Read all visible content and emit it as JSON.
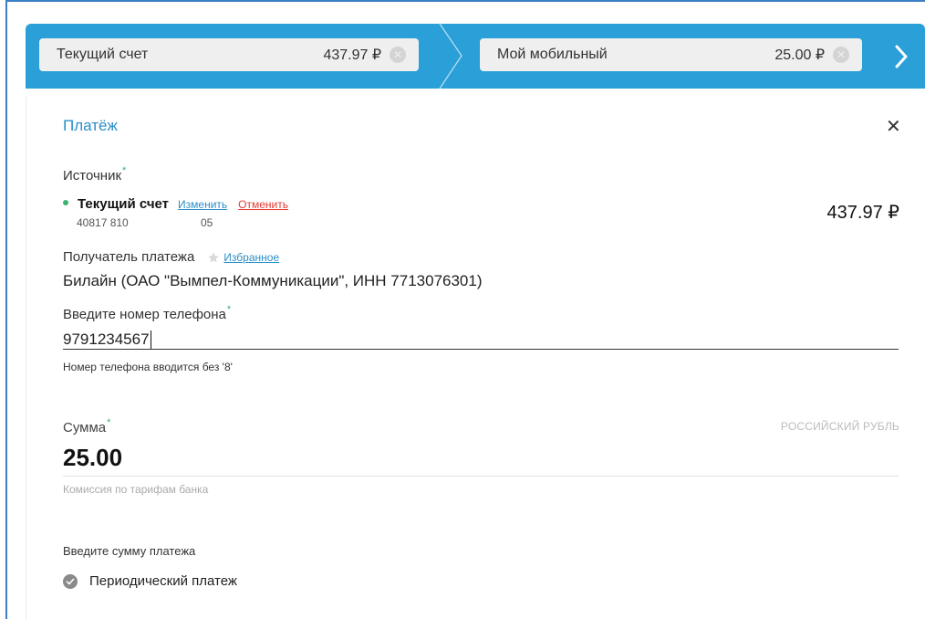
{
  "header": {
    "source_chip": {
      "label": "Текущий счет",
      "amount": "437.97 ₽"
    },
    "target_chip": {
      "label": "Мой мобильный",
      "amount": "25.00 ₽"
    }
  },
  "form": {
    "title": "Платёж",
    "source": {
      "label": "Источник",
      "required_mark": "*",
      "account_name": "Текущий счет",
      "change_link": "Изменить",
      "cancel_link": "Отменить",
      "account_number": "40817 810",
      "account_number_end": "05",
      "balance": "437.97 ₽"
    },
    "recipient": {
      "label": "Получатель платежа",
      "favorites_link": "Избранное",
      "value": "Билайн (ОАО \"Вымпел-Коммуникации\", ИНН 7713076301)"
    },
    "phone": {
      "label": "Введите номер телефона",
      "required_mark": "*",
      "value": "9791234567",
      "hint": "Номер телефона вводится без '8'"
    },
    "amount": {
      "label": "Сумма",
      "required_mark": "*",
      "currency": "РОССИЙСКИЙ РУБЛЬ",
      "value": "25.00",
      "commission": "Комиссия по тарифам банка"
    },
    "enter_amount_hint": "Введите сумму платежа",
    "periodic": {
      "label": "Периодический платеж",
      "checked": false
    }
  },
  "colors": {
    "accent": "#2a9fd8",
    "link": "#2a8fc8",
    "cancel": "#e53935",
    "required": "#3cb371"
  }
}
